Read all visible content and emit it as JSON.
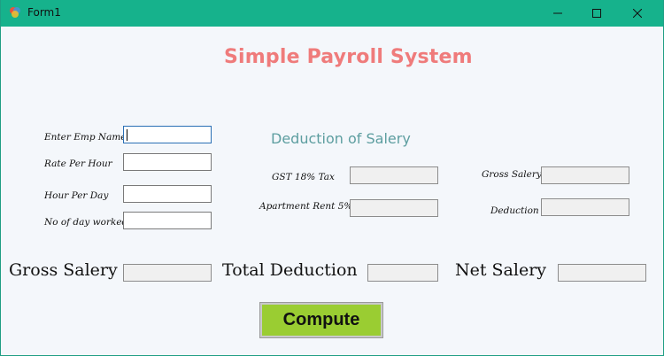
{
  "window": {
    "title": "Form1",
    "icon": "app-icon",
    "controls": [
      "minimize-icon",
      "maximize-icon",
      "close-icon"
    ]
  },
  "heading": "Simple Payroll System",
  "employee": {
    "emp_name_label": "Enter Emp Name",
    "emp_name_value": "",
    "rate_label": "Rate Per Hour",
    "rate_value": "",
    "hour_label": "Hour Per Day",
    "hour_value": "",
    "days_label": "No of day worked",
    "days_value": ""
  },
  "deduction": {
    "title": "Deduction of Salery",
    "gst_label": "GST 18% Tax",
    "gst_value": "",
    "rent_label": "Apartment Rent 5%",
    "rent_value": "",
    "gross_label": "Gross Salery",
    "gross_value": "",
    "deduction_label": "Deduction",
    "deduction_value": ""
  },
  "summary": {
    "gross_label": "Gross Salery",
    "gross_value": "",
    "total_deduction_label": "Total Deduction",
    "total_deduction_value": "",
    "net_label": "Net Salery",
    "net_value": ""
  },
  "compute_label": "Compute",
  "colors": {
    "titlebar": "#16b28c",
    "heading": "#ef7b7b",
    "subheading": "#5d9ea0",
    "compute_button": "#9acd32",
    "form_background": "#f4f7fb"
  }
}
